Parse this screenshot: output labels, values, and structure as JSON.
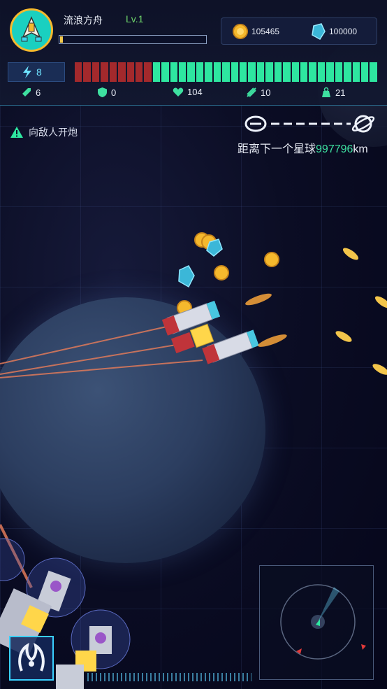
{
  "player": {
    "ship_name": "流浪方舟",
    "level": "Lv.1",
    "exp_progress": 0.02
  },
  "resources": {
    "gold": "105465",
    "crystal": "100000"
  },
  "energy": "8",
  "hp": {
    "filled_segments": 26,
    "total_segments": 35,
    "damaged_color": "#a3292c",
    "healthy_color": "#2ee6a0"
  },
  "stats": {
    "attack": "6",
    "shield": "0",
    "health": "104",
    "speed": "10",
    "cargo": "21"
  },
  "objective": "向敌人开炮",
  "distance": {
    "prefix": "距离下一个星球",
    "value": "997796",
    "unit": "km"
  },
  "colors": {
    "accent": "#3ee0a0",
    "hud_border": "#2a6b8c",
    "gold": "#f5b92d",
    "crystal": "#3bb7d8",
    "laser": "#e07a5a"
  }
}
